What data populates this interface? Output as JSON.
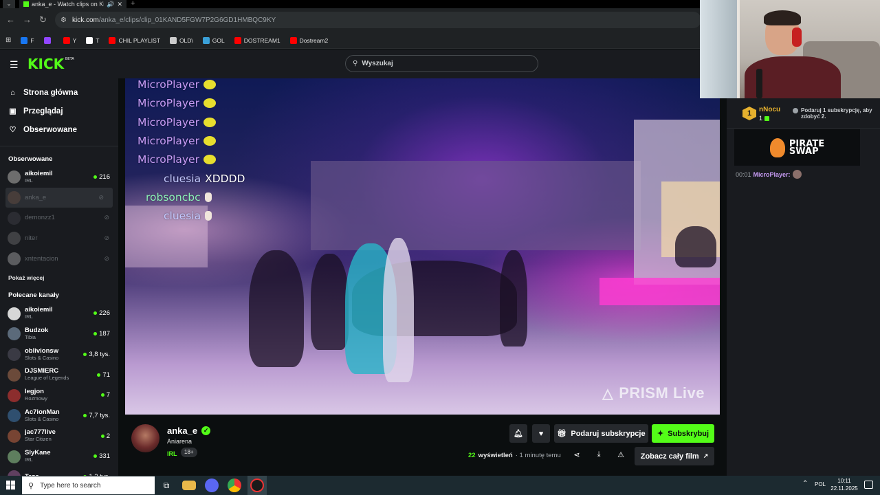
{
  "browser": {
    "tab_title": "anka_e - Watch clips on Kick",
    "url_host": "kick.com",
    "url_path": "/anka_e/clips/clip_01KAND5FGW7P2G6GD1HMBQC9KY",
    "bookmarks": [
      {
        "label": "F",
        "color": "#1877f2"
      },
      {
        "label": "",
        "color": "#9146ff"
      },
      {
        "label": "Y",
        "color": "#ff0000"
      },
      {
        "label": "T",
        "color": "#ffffff"
      },
      {
        "label": "CHIL PLAYLIST",
        "color": "#ff0000"
      },
      {
        "label": "OLD\\",
        "color": "#cccccc"
      },
      {
        "label": "GOL",
        "color": "#3aa0d8"
      },
      {
        "label": "DOSTREAM1",
        "color": "#ff0000"
      },
      {
        "label": "Dostream2",
        "color": "#ff0000"
      }
    ]
  },
  "header": {
    "logo": "KICK",
    "logo_badge": "BETA",
    "search_placeholder": "Wyszukaj"
  },
  "sidebar": {
    "nav": [
      {
        "label": "Strona główna",
        "icon": "home-icon",
        "glyph": "⌂"
      },
      {
        "label": "Przeglądaj",
        "icon": "browse-icon",
        "glyph": "▣"
      },
      {
        "label": "Obserwowane",
        "icon": "heart-icon",
        "glyph": "♡"
      }
    ],
    "followed_heading": "Obserwowane",
    "followed": [
      {
        "name": "aikoiemil",
        "category": "IRL",
        "viewers": "216",
        "live": true
      },
      {
        "name": "anka_e",
        "category": "",
        "viewers": "",
        "live": false,
        "active": true
      },
      {
        "name": "demonzz1",
        "category": "",
        "viewers": "",
        "live": false
      },
      {
        "name": "niter",
        "category": "",
        "viewers": "",
        "live": false
      },
      {
        "name": "xntentacion",
        "category": "",
        "viewers": "",
        "live": false
      }
    ],
    "show_more": "Pokaż więcej",
    "recommended_heading": "Polecane kanały",
    "recommended": [
      {
        "name": "aikoiemil",
        "category": "IRL",
        "viewers": "226"
      },
      {
        "name": "Budzok",
        "category": "Tibia",
        "viewers": "187"
      },
      {
        "name": "oblivionsw",
        "category": "Slots & Casino",
        "viewers": "3,8 tys."
      },
      {
        "name": "DJSMIERC",
        "category": "League of Legends",
        "viewers": "71"
      },
      {
        "name": "legjon",
        "category": "Rozmowy",
        "viewers": "7"
      },
      {
        "name": "Ac7ionMan",
        "category": "Slots & Casino",
        "viewers": "7,7 tys."
      },
      {
        "name": "jac777live",
        "category": "Star Citizen",
        "viewers": "2"
      },
      {
        "name": "SlyKane",
        "category": "IRL",
        "viewers": "331"
      },
      {
        "name": "Tazo",
        "category": "",
        "viewers": "1,2 tys."
      }
    ]
  },
  "video_overlay": {
    "chat": [
      {
        "user": "MicroPlayer",
        "message": "",
        "emote": "yellow"
      },
      {
        "user": "MicroPlayer",
        "message": "",
        "emote": "yellow"
      },
      {
        "user": "MicroPlayer",
        "message": "",
        "emote": "yellow"
      },
      {
        "user": "MicroPlayer",
        "message": "",
        "emote": "yellow"
      },
      {
        "user": "MicroPlayer",
        "message": "",
        "emote": "yellow"
      },
      {
        "user": "cluesia",
        "message": "XDDDD",
        "emote": ""
      },
      {
        "user": "robsoncbc",
        "message": "",
        "emote": "hand"
      },
      {
        "user": "cluesia",
        "message": "",
        "emote": "hand"
      }
    ],
    "watermark": "PRISM Live"
  },
  "clip_info": {
    "streamer": "anka_e",
    "title": "Aniarena",
    "category": "IRL",
    "age_badge": "18+",
    "views": "22",
    "views_label": "wyświetleń",
    "time_ago": "· 1 minutę temu",
    "gift_button": "Podaruj subskrypcje",
    "subscribe_button": "Subskrybuj",
    "full_video_button": "Zobacz cały film"
  },
  "chat": {
    "goal_user": "nNocu",
    "goal_count": "1",
    "goal_badge": "1",
    "goal_text": "Podaruj 1 subskrypcję, aby zdobyć 2.",
    "ad_text_line1": "PIRATE",
    "ad_text_line2": "SWAP",
    "message": {
      "time": "00:01",
      "user": "MicroPlayer:"
    }
  },
  "taskbar": {
    "search_placeholder": "Type here to search",
    "language": "POL",
    "time": "10:11",
    "date": "22.11.2025"
  }
}
